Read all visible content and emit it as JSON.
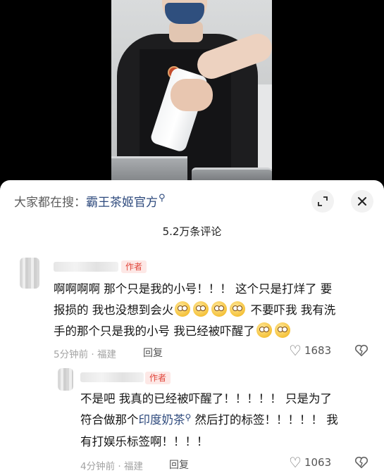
{
  "sheet": {
    "search_prefix": "大家都在搜：",
    "search_term": "霸王茶姬官方",
    "comment_count": "5.2万条评论"
  },
  "icons": {
    "search": "⚲",
    "expand": "⤢",
    "close": "✕",
    "heart": "♡",
    "dislike": "♡"
  },
  "comments": [
    {
      "author_tag": "作者",
      "line1": "啊啊啊啊 那个只是我的小号！！！ 这个只是打烊了 要",
      "line2": "报损的 我也没想到会火",
      "line2_after": " 不要吓我 我有洗",
      "line3": "手的那个只是我的小号 我已经被吓醒了",
      "time_location": "5分钟前 · 福建",
      "reply_label": "回复",
      "likes": "1683"
    },
    {
      "author_tag": "作者",
      "line1": "不是吧 我真的已经被吓醒了！！！！！ 只是为了",
      "line2_before": "符合做那个",
      "line2_link": "印度奶茶",
      "line2_after": " 然后打的标签！！！！！ 我",
      "line3": "有打娱乐标签啊！！！！",
      "time_location": "4分钟前 · 福建",
      "reply_label": "回复",
      "likes": "1063"
    }
  ]
}
